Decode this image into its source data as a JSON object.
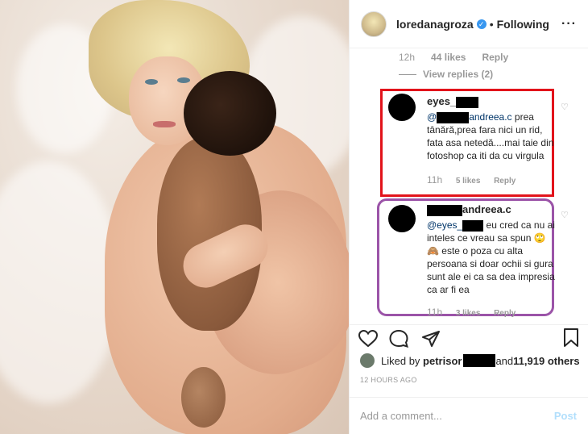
{
  "post": {
    "username": "loredanagroza",
    "verified_mark": "✓",
    "dot": "•",
    "follow_status": "Following",
    "more": "···"
  },
  "prev_comment": {
    "time": "12h",
    "likes": "44 likes",
    "reply": "Reply",
    "view_replies": "View replies (2)"
  },
  "comment1": {
    "user": "eyes_",
    "mention_suffix": "andreea.c",
    "text": "prea tânără,prea fara nici un rid, fata asa netedă....mai taie din fotoshop ca iti da cu virgula",
    "time": "11h",
    "likes": "5 likes",
    "reply": "Reply"
  },
  "comment2": {
    "user": "andreea.c",
    "mention": "@eyes_",
    "text_1": "eu cred ca nu ai inteles ce vreau sa spun",
    "emojis": "🙄🙈",
    "text_2": "este o poza cu alta persoana si doar ochii si gura sunt ale ei ca sa dea impresia ca ar fi ea",
    "time": "11h",
    "likes": "3 likes",
    "reply": "Reply"
  },
  "actions": {
    "like_icon": "heart-icon",
    "comment_icon": "comment-icon",
    "share_icon": "share-icon",
    "save_icon": "bookmark-icon"
  },
  "likes": {
    "prefix": "Liked by ",
    "user": "petrisor",
    "suffix": " and ",
    "others": "11,919 others"
  },
  "timestamp": "12 HOURS AGO",
  "add_comment": {
    "placeholder": "Add a comment...",
    "post": "Post"
  },
  "colors": {
    "highlight_red": "#e2131b",
    "highlight_purple": "#9b54a8",
    "verified": "#3897f0"
  }
}
